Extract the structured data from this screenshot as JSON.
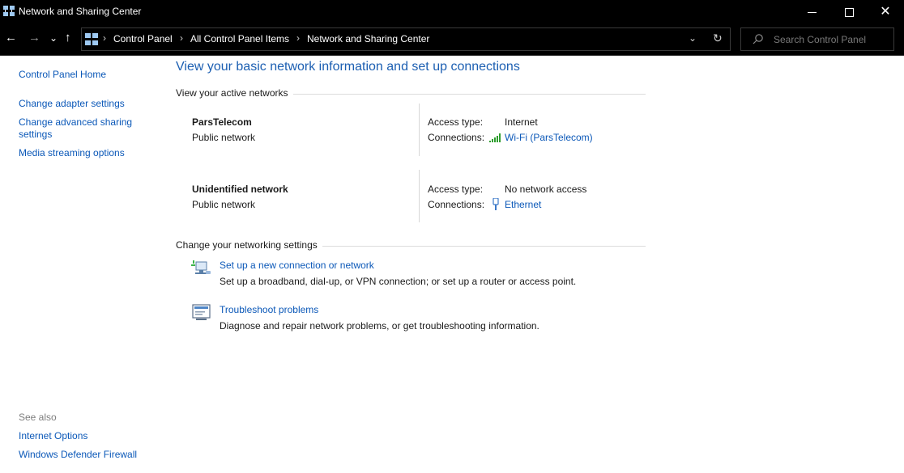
{
  "window": {
    "title": "Network and Sharing Center",
    "icon": "network-center-icon"
  },
  "titlebar_buttons": {
    "minimize": "minimize-icon",
    "maximize": "maximize-icon",
    "close_glyph": "✕"
  },
  "nav": {
    "back_glyph": "←",
    "forward_glyph": "→",
    "recent_glyph": "⌄",
    "up_glyph": "↑",
    "breadcrumb": [
      "Control Panel",
      "All Control Panel Items",
      "Network and Sharing Center"
    ],
    "separator": "›",
    "dropdown_glyph": "⌄",
    "refresh_glyph": "↻",
    "search_placeholder": "Search Control Panel"
  },
  "sidebar": {
    "home": "Control Panel Home",
    "links": [
      "Change adapter settings",
      "Change advanced sharing",
      "settings",
      "Media streaming options"
    ],
    "see_also_title": "See also",
    "see_also": [
      "Internet Options",
      "Windows Defender Firewall"
    ]
  },
  "main": {
    "heading": "View your basic network information and set up connections",
    "active_networks_label": "View your active networks",
    "networks": [
      {
        "name": "ParsTelecom",
        "type": "Public network",
        "access_label": "Access type:",
        "access_value": "Internet",
        "connections_label": "Connections:",
        "connection": "Wi-Fi (ParsTelecom)",
        "connection_icon": "wifi-signal-icon"
      },
      {
        "name": "Unidentified network",
        "type": "Public network",
        "access_label": "Access type:",
        "access_value": "No network access",
        "connections_label": "Connections:",
        "connection": "Ethernet",
        "connection_icon": "ethernet-icon"
      }
    ],
    "settings_label": "Change your networking settings",
    "tasks": [
      {
        "link": "Set up a new connection or network",
        "desc": "Set up a broadband, dial-up, or VPN connection; or set up a router or access point.",
        "icon": "new-connection-icon"
      },
      {
        "link": "Troubleshoot problems",
        "desc": "Diagnose and repair network problems, or get troubleshooting information.",
        "icon": "troubleshoot-icon"
      }
    ]
  },
  "colors": {
    "link": "#0b58b8",
    "heading": "#1c5fb2",
    "titlebar": "#000000",
    "signal": "#2f9e2f"
  }
}
